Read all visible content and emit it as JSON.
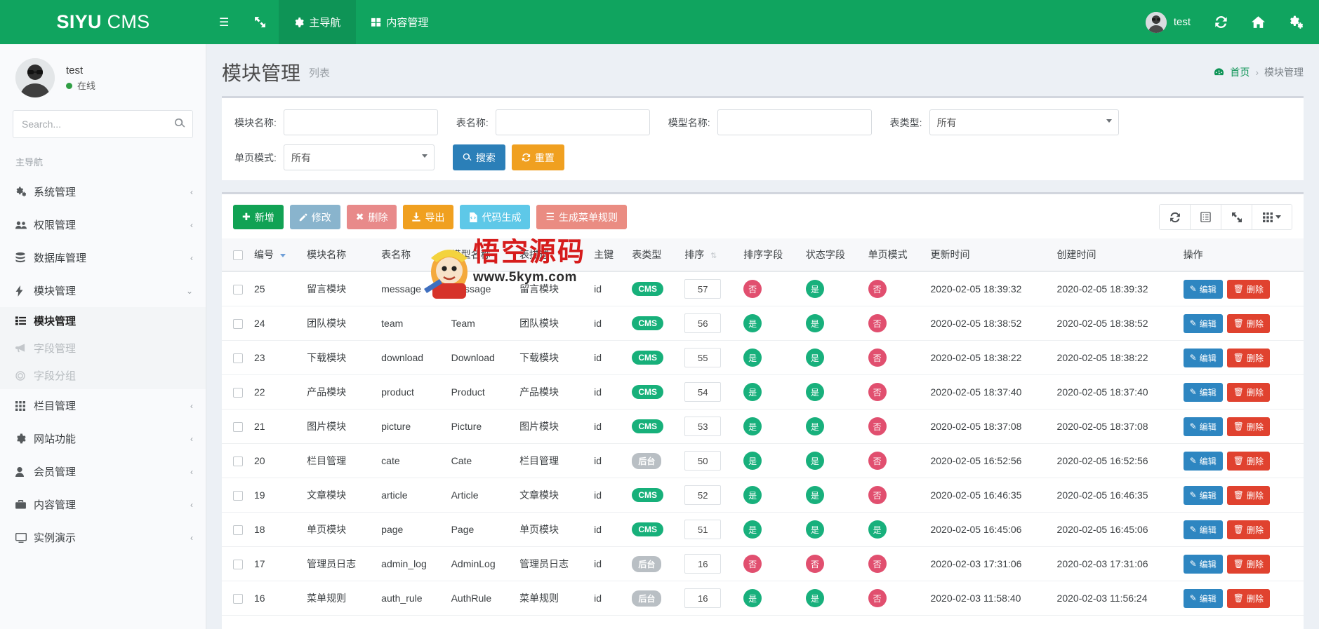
{
  "brand": {
    "bold": "SIYU",
    "light": "CMS"
  },
  "topnav": {
    "hamburger_icon": "bars-icon",
    "expand_icon": "expand-arrows-icon",
    "items": [
      {
        "label": "主导航",
        "icon": "gear-icon",
        "active": true
      },
      {
        "label": "内容管理",
        "icon": "grid-icon",
        "active": false
      }
    ],
    "right": {
      "user_label": "test",
      "avatar_icon": "avatar",
      "refresh_icon": "refresh-icon",
      "home_icon": "home-icon",
      "settings_icon": "gears-icon"
    }
  },
  "sidebar": {
    "user": {
      "name": "test",
      "status": "在线"
    },
    "search": {
      "placeholder": "Search...",
      "value": "",
      "icon": "search-icon"
    },
    "section_title": "主导航",
    "items": [
      {
        "label": "系统管理",
        "icon": "gears-icon",
        "arrow": "chevron-left-icon"
      },
      {
        "label": "权限管理",
        "icon": "users-icon",
        "arrow": "chevron-left-icon"
      },
      {
        "label": "数据库管理",
        "icon": "database-icon",
        "arrow": "chevron-left-icon"
      },
      {
        "label": "模块管理",
        "icon": "bolt-icon",
        "arrow": "chevron-down-icon",
        "expanded": true
      },
      {
        "label": "栏目管理",
        "icon": "th-icon",
        "arrow": "chevron-left-icon"
      },
      {
        "label": "网站功能",
        "icon": "cog-icon",
        "arrow": "chevron-left-icon"
      },
      {
        "label": "会员管理",
        "icon": "user-icon",
        "arrow": "chevron-left-icon"
      },
      {
        "label": "内容管理",
        "icon": "briefcase-icon",
        "arrow": "chevron-left-icon"
      },
      {
        "label": "实例演示",
        "icon": "desktop-icon",
        "arrow": "chevron-left-icon"
      }
    ],
    "submenu": [
      {
        "label": "模块管理",
        "icon": "list-icon",
        "active": true
      },
      {
        "label": "字段管理",
        "icon": "bullhorn-icon",
        "active": false
      },
      {
        "label": "字段分组",
        "icon": "circle-target-icon",
        "active": false
      }
    ]
  },
  "page": {
    "title": "模块管理",
    "subtitle": "列表",
    "breadcrumb": {
      "home_icon": "dashboard-icon",
      "home": "首页",
      "sep": "›",
      "current": "模块管理"
    }
  },
  "filters": {
    "row1": [
      {
        "label": "模块名称:",
        "type": "text",
        "value": "",
        "name": "module-name"
      },
      {
        "label": "表名称:",
        "type": "text",
        "value": "",
        "name": "table-name"
      },
      {
        "label": "模型名称:",
        "type": "text",
        "value": "",
        "name": "model-name"
      },
      {
        "label": "表类型:",
        "type": "select",
        "value": "所有",
        "name": "table-type"
      }
    ],
    "row2": [
      {
        "label": "单页模式:",
        "type": "select",
        "value": "所有",
        "name": "single-page-mode"
      }
    ],
    "search_button": {
      "label": "搜索",
      "icon": "search-icon"
    },
    "reset_button": {
      "label": "重置",
      "icon": "refresh-icon"
    }
  },
  "toolbar": {
    "buttons": [
      {
        "label": "新增",
        "icon": "plus-icon",
        "color": "bg-green"
      },
      {
        "label": "修改",
        "icon": "edit-icon",
        "color": "bg-blue-l"
      },
      {
        "label": "删除",
        "icon": "times-icon",
        "color": "bg-red-l"
      },
      {
        "label": "导出",
        "icon": "download-icon",
        "color": "bg-orange"
      },
      {
        "label": "代码生成",
        "icon": "file-code-icon",
        "color": "bg-cyan"
      },
      {
        "label": "生成菜单规则",
        "icon": "bars-icon",
        "color": "bg-salmon"
      }
    ],
    "right_icons": [
      {
        "name": "refresh-icon",
        "glyph": "⟳"
      },
      {
        "name": "list-view-icon",
        "glyph": "▤"
      },
      {
        "name": "fullscreen-icon",
        "glyph": "⤢"
      },
      {
        "name": "columns-icon",
        "glyph": "▦"
      }
    ]
  },
  "table": {
    "columns": [
      "编号",
      "模块名称",
      "表名称",
      "模型名称",
      "表描述",
      "主键",
      "表类型",
      "排序",
      "排序字段",
      "状态字段",
      "单页模式",
      "更新时间",
      "创建时间",
      "操作"
    ],
    "actions": {
      "edit": "编辑",
      "delete": "删除"
    },
    "rows": [
      {
        "id": "25",
        "module": "留言模块",
        "table": "message",
        "model": "Message",
        "desc": "留言模块",
        "pk": "id",
        "type": "CMS",
        "type_kind": "cms",
        "sort": "57",
        "sort_field": "否",
        "status_field": "是",
        "single_page": "否",
        "updated": "2020-02-05 18:39:32",
        "created": "2020-02-05 18:39:32"
      },
      {
        "id": "24",
        "module": "团队模块",
        "table": "team",
        "model": "Team",
        "desc": "团队模块",
        "pk": "id",
        "type": "CMS",
        "type_kind": "cms",
        "sort": "56",
        "sort_field": "是",
        "status_field": "是",
        "single_page": "否",
        "updated": "2020-02-05 18:38:52",
        "created": "2020-02-05 18:38:52"
      },
      {
        "id": "23",
        "module": "下载模块",
        "table": "download",
        "model": "Download",
        "desc": "下载模块",
        "pk": "id",
        "type": "CMS",
        "type_kind": "cms",
        "sort": "55",
        "sort_field": "是",
        "status_field": "是",
        "single_page": "否",
        "updated": "2020-02-05 18:38:22",
        "created": "2020-02-05 18:38:22"
      },
      {
        "id": "22",
        "module": "产品模块",
        "table": "product",
        "model": "Product",
        "desc": "产品模块",
        "pk": "id",
        "type": "CMS",
        "type_kind": "cms",
        "sort": "54",
        "sort_field": "是",
        "status_field": "是",
        "single_page": "否",
        "updated": "2020-02-05 18:37:40",
        "created": "2020-02-05 18:37:40"
      },
      {
        "id": "21",
        "module": "图片模块",
        "table": "picture",
        "model": "Picture",
        "desc": "图片模块",
        "pk": "id",
        "type": "CMS",
        "type_kind": "cms",
        "sort": "53",
        "sort_field": "是",
        "status_field": "是",
        "single_page": "否",
        "updated": "2020-02-05 18:37:08",
        "created": "2020-02-05 18:37:08"
      },
      {
        "id": "20",
        "module": "栏目管理",
        "table": "cate",
        "model": "Cate",
        "desc": "栏目管理",
        "pk": "id",
        "type": "后台",
        "type_kind": "admin",
        "sort": "50",
        "sort_field": "是",
        "status_field": "是",
        "single_page": "否",
        "updated": "2020-02-05 16:52:56",
        "created": "2020-02-05 16:52:56"
      },
      {
        "id": "19",
        "module": "文章模块",
        "table": "article",
        "model": "Article",
        "desc": "文章模块",
        "pk": "id",
        "type": "CMS",
        "type_kind": "cms",
        "sort": "52",
        "sort_field": "是",
        "status_field": "是",
        "single_page": "否",
        "updated": "2020-02-05 16:46:35",
        "created": "2020-02-05 16:46:35"
      },
      {
        "id": "18",
        "module": "单页模块",
        "table": "page",
        "model": "Page",
        "desc": "单页模块",
        "pk": "id",
        "type": "CMS",
        "type_kind": "cms",
        "sort": "51",
        "sort_field": "是",
        "status_field": "是",
        "single_page": "是",
        "updated": "2020-02-05 16:45:06",
        "created": "2020-02-05 16:45:06"
      },
      {
        "id": "17",
        "module": "管理员日志",
        "table": "admin_log",
        "model": "AdminLog",
        "desc": "管理员日志",
        "pk": "id",
        "type": "后台",
        "type_kind": "admin",
        "sort": "16",
        "sort_field": "否",
        "status_field": "否",
        "single_page": "否",
        "updated": "2020-02-03 17:31:06",
        "created": "2020-02-03 17:31:06"
      },
      {
        "id": "16",
        "module": "菜单规则",
        "table": "auth_rule",
        "model": "AuthRule",
        "desc": "菜单规则",
        "pk": "id",
        "type": "后台",
        "type_kind": "admin",
        "sort": "16",
        "sort_field": "是",
        "status_field": "是",
        "single_page": "否",
        "updated": "2020-02-03 11:58:40",
        "created": "2020-02-03 11:56:24"
      }
    ]
  },
  "watermark": {
    "text": "悟空源码",
    "url": "www.5kym.com"
  },
  "colors": {
    "brand_green": "#10a45f",
    "accent_blue": "#2b7fb8",
    "danger_red": "#e14f6f",
    "success_green": "#18b07c",
    "warning_orange": "#f0a020"
  }
}
